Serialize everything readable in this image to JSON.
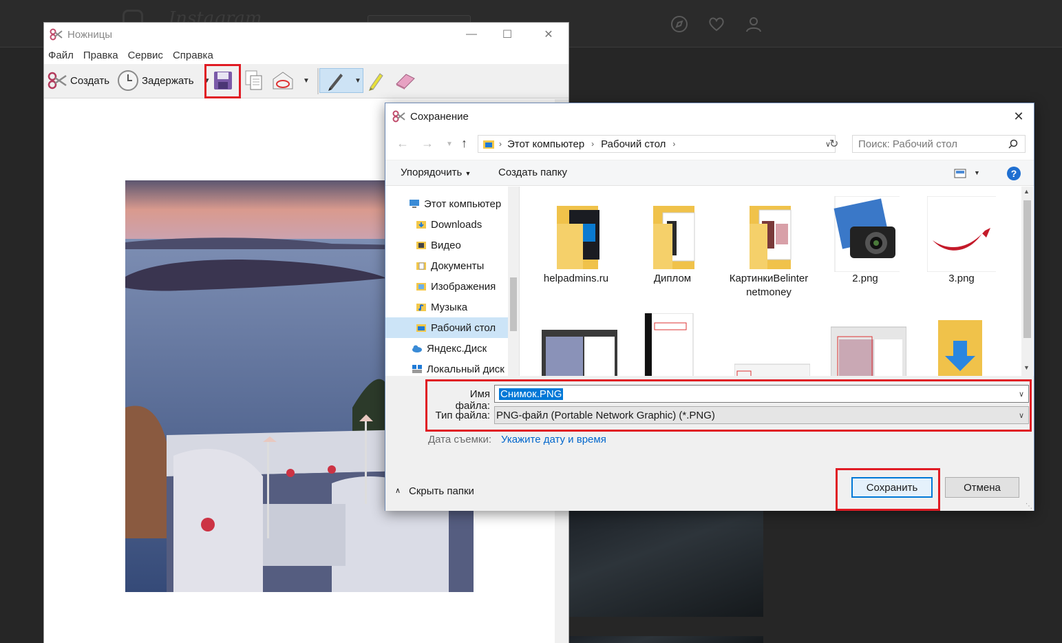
{
  "instagram": {
    "logo_text": "Instagram"
  },
  "snipping_tool": {
    "title": "Ножницы",
    "menu": [
      "Файл",
      "Правка",
      "Сервис",
      "Справка"
    ],
    "toolbar": {
      "new_label": "Создать",
      "delay_label": "Задержать"
    }
  },
  "save_dialog": {
    "title": "Сохранение",
    "breadcrumb": [
      "Этот компьютер",
      "Рабочий стол"
    ],
    "search_placeholder": "Поиск: Рабочий стол",
    "organize_label": "Упорядочить",
    "new_folder_label": "Создать папку",
    "nav_items": [
      {
        "label": "Этот компьютер",
        "icon": "computer-icon"
      },
      {
        "label": "Downloads",
        "icon": "folder-icon"
      },
      {
        "label": "Видео",
        "icon": "video-folder-icon"
      },
      {
        "label": "Документы",
        "icon": "documents-folder-icon"
      },
      {
        "label": "Изображения",
        "icon": "pictures-folder-icon"
      },
      {
        "label": "Музыка",
        "icon": "music-folder-icon"
      },
      {
        "label": "Рабочий стол",
        "icon": "desktop-folder-icon",
        "selected": true
      },
      {
        "label": "Яндекс.Диск",
        "icon": "cloud-icon"
      },
      {
        "label": "Локальный диск",
        "icon": "drive-icon"
      }
    ],
    "files": [
      {
        "name": "helpadmins.ru",
        "type": "folder"
      },
      {
        "name": "Диплом",
        "type": "folder"
      },
      {
        "name": "КартинкиBelinter netmoney",
        "type": "folder"
      },
      {
        "name": "2.png",
        "type": "image"
      },
      {
        "name": "3.png",
        "type": "image"
      }
    ],
    "filename_label": "Имя файла:",
    "filename_value": "Снимок.PNG",
    "filetype_label": "Тип файла:",
    "filetype_value": "PNG-файл (Portable Network Graphic) (*.PNG)",
    "date_label": "Дата съемки:",
    "date_link": "Укажите дату и время",
    "hide_folders_label": "Скрыть папки",
    "save_label": "Сохранить",
    "cancel_label": "Отмена"
  },
  "colors": {
    "highlight_red": "#e01b24",
    "link_blue": "#0066cc",
    "selection": "#cce4f7",
    "accent": "#0078d7"
  }
}
